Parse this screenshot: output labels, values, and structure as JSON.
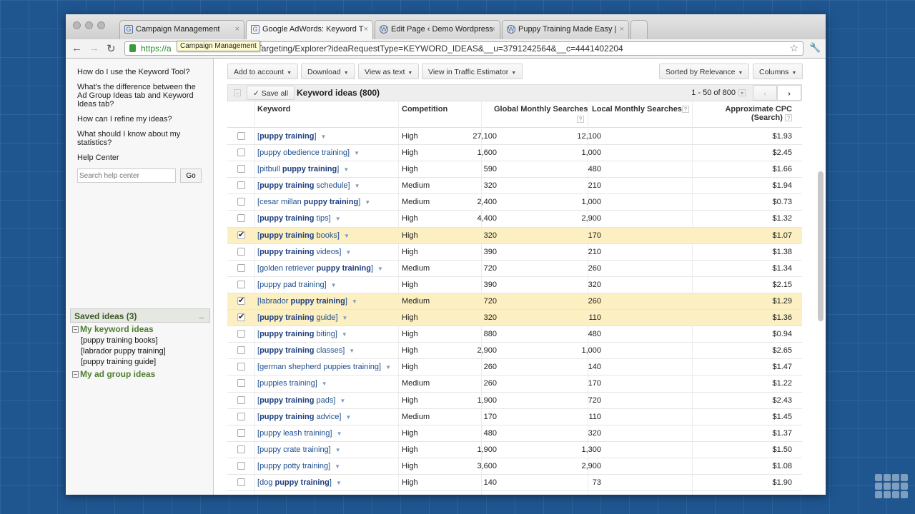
{
  "browser": {
    "tabs": [
      {
        "title": "Campaign Management"
      },
      {
        "title": "Google AdWords: Keyword T"
      },
      {
        "title": "Edit Page ‹ Demo Wordpress"
      },
      {
        "title": "Puppy Training Made Easy |"
      }
    ],
    "url_scheme": "https://a",
    "url_rest": "o/Targeting/Explorer?ideaRequestType=KEYWORD_IDEAS&__u=3791242564&__c=4441402204",
    "tooltip": "Campaign Management"
  },
  "sidebar": {
    "help_links": [
      "How do I use the Keyword Tool?",
      "What's the difference between the Ad Group Ideas tab and Keyword Ideas tab?",
      "How can I refine my ideas?",
      "What should I know about my statistics?",
      "Help Center"
    ],
    "search_placeholder": "Search help center",
    "go": "Go",
    "saved_title": "Saved ideas (3)",
    "group1": "My keyword ideas",
    "saved_items": [
      "[puppy training books]",
      "[labrador puppy training]",
      "[puppy training guide]"
    ],
    "group2": "My ad group ideas"
  },
  "toolbar": {
    "add": "Add to account",
    "download": "Download",
    "view_text": "View as text",
    "traffic": "View in Traffic Estimator",
    "sort": "Sorted by Relevance",
    "columns": "Columns"
  },
  "keywords": {
    "save_all": "✓ Save all",
    "title": "Keyword ideas (800)",
    "pagination": "1 - 50 of 800",
    "headers": {
      "keyword": "Keyword",
      "competition": "Competition",
      "global": "Global Monthly Searches",
      "local": "Local Monthly Searches",
      "cpc": "Approximate CPC",
      "cpc2": "(Search)"
    },
    "rows": [
      {
        "pre": "",
        "bold": "puppy training",
        "post": "",
        "comp": "High",
        "global": "27,100",
        "local": "12,100",
        "cpc": "$1.93",
        "checked": false
      },
      {
        "pre": "puppy obedience training",
        "bold": "",
        "post": "",
        "comp": "High",
        "global": "1,600",
        "local": "1,000",
        "cpc": "$2.45",
        "checked": false
      },
      {
        "pre": "pitbull ",
        "bold": "puppy training",
        "post": "",
        "comp": "High",
        "global": "590",
        "local": "480",
        "cpc": "$1.66",
        "checked": false
      },
      {
        "pre": "",
        "bold": "puppy training",
        "post": " schedule",
        "comp": "Medium",
        "global": "320",
        "local": "210",
        "cpc": "$1.94",
        "checked": false
      },
      {
        "pre": "cesar millan ",
        "bold": "puppy training",
        "post": "",
        "comp": "Medium",
        "global": "2,400",
        "local": "1,000",
        "cpc": "$0.73",
        "checked": false
      },
      {
        "pre": "",
        "bold": "puppy training",
        "post": " tips",
        "comp": "High",
        "global": "4,400",
        "local": "2,900",
        "cpc": "$1.32",
        "checked": false
      },
      {
        "pre": "",
        "bold": "puppy training",
        "post": " books",
        "comp": "High",
        "global": "320",
        "local": "170",
        "cpc": "$1.07",
        "checked": true
      },
      {
        "pre": "",
        "bold": "puppy training",
        "post": " videos",
        "comp": "High",
        "global": "390",
        "local": "210",
        "cpc": "$1.38",
        "checked": false
      },
      {
        "pre": "golden retriever ",
        "bold": "puppy training",
        "post": "",
        "comp": "Medium",
        "global": "720",
        "local": "260",
        "cpc": "$1.34",
        "checked": false
      },
      {
        "pre": "puppy pad training",
        "bold": "",
        "post": "",
        "comp": "High",
        "global": "390",
        "local": "320",
        "cpc": "$2.15",
        "checked": false
      },
      {
        "pre": "labrador ",
        "bold": "puppy training",
        "post": "",
        "comp": "Medium",
        "global": "720",
        "local": "260",
        "cpc": "$1.29",
        "checked": true
      },
      {
        "pre": "",
        "bold": "puppy training",
        "post": " guide",
        "comp": "High",
        "global": "320",
        "local": "110",
        "cpc": "$1.36",
        "checked": true
      },
      {
        "pre": "",
        "bold": "puppy training",
        "post": " biting",
        "comp": "High",
        "global": "880",
        "local": "480",
        "cpc": "$0.94",
        "checked": false
      },
      {
        "pre": "",
        "bold": "puppy training",
        "post": " classes",
        "comp": "High",
        "global": "2,900",
        "local": "1,000",
        "cpc": "$2.65",
        "checked": false
      },
      {
        "pre": "german shepherd puppies training",
        "bold": "",
        "post": "",
        "comp": "High",
        "global": "260",
        "local": "140",
        "cpc": "$1.47",
        "checked": false
      },
      {
        "pre": "puppies training",
        "bold": "",
        "post": "",
        "comp": "Medium",
        "global": "260",
        "local": "170",
        "cpc": "$1.22",
        "checked": false
      },
      {
        "pre": "",
        "bold": "puppy training",
        "post": " pads",
        "comp": "High",
        "global": "1,900",
        "local": "720",
        "cpc": "$2.43",
        "checked": false
      },
      {
        "pre": "",
        "bold": "puppy training",
        "post": " advice",
        "comp": "Medium",
        "global": "170",
        "local": "110",
        "cpc": "$1.45",
        "checked": false
      },
      {
        "pre": "puppy leash training",
        "bold": "",
        "post": "",
        "comp": "High",
        "global": "480",
        "local": "320",
        "cpc": "$1.37",
        "checked": false
      },
      {
        "pre": "puppy crate training",
        "bold": "",
        "post": "",
        "comp": "High",
        "global": "1,900",
        "local": "1,300",
        "cpc": "$1.50",
        "checked": false
      },
      {
        "pre": "puppy potty training",
        "bold": "",
        "post": "",
        "comp": "High",
        "global": "3,600",
        "local": "2,900",
        "cpc": "$1.08",
        "checked": false
      },
      {
        "pre": "dog ",
        "bold": "puppy training",
        "post": "",
        "comp": "High",
        "global": "140",
        "local": "73",
        "cpc": "$1.90",
        "checked": false
      }
    ]
  }
}
